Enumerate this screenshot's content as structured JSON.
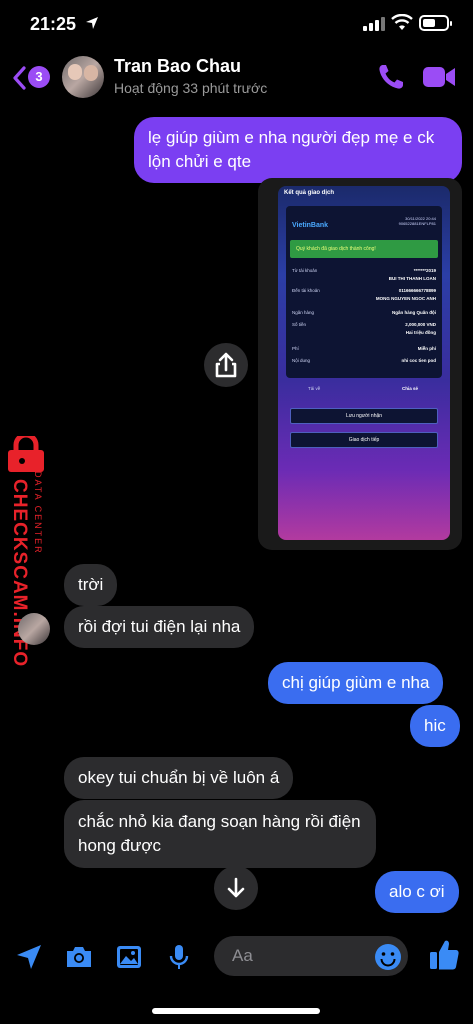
{
  "status_bar": {
    "time": "21:25"
  },
  "header": {
    "unread_count": "3",
    "contact_name": "Tran Bao Chau",
    "presence": "Hoạt động 33 phút trước"
  },
  "colors": {
    "accent": "#9b4cf5",
    "outgoing_bubble": "#7b3ff2",
    "outgoing_bubble_alt": "#3a6df0",
    "incoming_bubble": "#2c2c2e"
  },
  "messages": [
    {
      "from": "me",
      "text": "lẹ giúp giùm e nha người đẹp mẹ e ck lộn chửi e qte"
    },
    {
      "from": "me",
      "type": "image"
    },
    {
      "from": "them",
      "text": "trời"
    },
    {
      "from": "them",
      "text": "rồi đợi tui điện lại nha"
    },
    {
      "from": "me",
      "text": "chị giúp giùm e nha"
    },
    {
      "from": "me",
      "text": "hic"
    },
    {
      "from": "them",
      "text": "okey tui chuẩn bị về luôn á"
    },
    {
      "from": "them",
      "text": "chắc nhỏ kia đang soạn hàng rồi điện hong được"
    },
    {
      "from": "me",
      "text": "alo c ơi"
    }
  ],
  "receipt": {
    "screen_title": "Kết quả giao dịch",
    "bank": "VietinBank",
    "datetime": "30/11/2022 20:44",
    "ref": "906522881ENFLP81",
    "success": "Quý khách đã giao dịch thành công!",
    "rows": [
      {
        "k": "Từ tài khoản",
        "v": "*******2019"
      },
      {
        "k": "",
        "v": "BUI THI THANH LOAN"
      },
      {
        "k": "Đến tài khoản",
        "v": "011666666778899"
      },
      {
        "k": "",
        "v": "MONG NGUYEN NGOC ANH"
      },
      {
        "k": "Ngân hàng",
        "v": "Ngân hàng Quân đội"
      },
      {
        "k": "Số tiền",
        "v": "2,000,000 VND"
      },
      {
        "k": "",
        "v": "Hai triệu đồng"
      },
      {
        "k": "Phí",
        "v": "Miễn phí"
      },
      {
        "k": "Nội dung",
        "v": "nhi coc tien pod"
      }
    ],
    "save_label": "Tải về",
    "share_label": "Chia sẻ",
    "btn_save_recipient": "Lưu người nhận",
    "btn_continue": "Giao dịch tiếp"
  },
  "watermark": {
    "line1": "DATA CENTER",
    "line2": "CHECKSCAM.INFO"
  },
  "composer": {
    "placeholder": "Aa"
  }
}
